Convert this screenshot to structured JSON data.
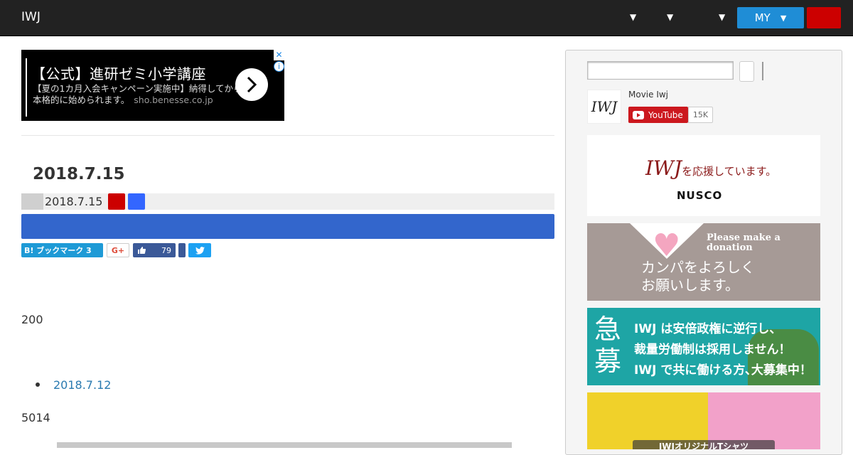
{
  "header": {
    "brand": "IWJ",
    "my_button": "MY",
    "colors": {
      "bar": "#222222",
      "my_button": "#1f8dd6",
      "red_button": "#cc0000"
    }
  },
  "ad": {
    "title": "【公式】進研ゼミ小学講座",
    "description": "【夏の1カ月入会キャンペーン実施中】納得してから本格的に始められます。",
    "domain": "sho.benesse.co.jp",
    "close_icon": "close-icon",
    "info_icon": "info-icon"
  },
  "post": {
    "title": "2018.7.15",
    "date": "2018.7.15"
  },
  "share": {
    "hatena_label": "B! ブックマーク 3",
    "gplus_label": "G+",
    "fb_count": "79"
  },
  "body": {
    "text_200": "200",
    "link": "2018.7.12",
    "text_5014": "5014"
  },
  "sidebar": {
    "youtube": {
      "logo_text": "IWJ",
      "channel_name": "Movie Iwj",
      "button_label": "YouTube",
      "count": "15K"
    },
    "nusco": {
      "line_brand": "IWJ",
      "line_text": "を応援しています。",
      "logo": "NUSCO"
    },
    "donate": {
      "en": "Please make a donation",
      "jp_line1": "カンパをよろしく",
      "jp_line2": "お願いします。"
    },
    "recruit": {
      "big1": "急",
      "big2": "募",
      "line1": "IWJ は安倍政権に逆行し、",
      "line2": "裁量労働制は採用しません！",
      "line3": "IWJ で共に働ける方､大募集中！"
    },
    "shirt": {
      "label": "IWJオリジナルTシャツ"
    }
  }
}
